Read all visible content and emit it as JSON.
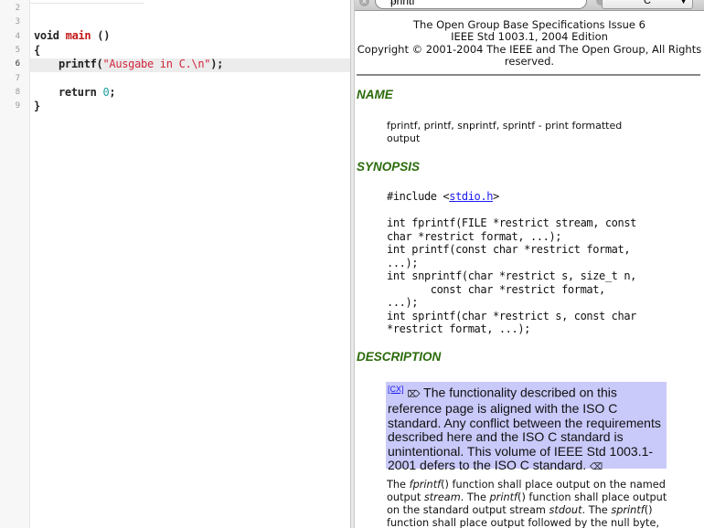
{
  "editor": {
    "line_numbers": [
      "2",
      "3",
      "4",
      "5",
      "6",
      "7",
      "8",
      "9"
    ],
    "current_line": "6",
    "code": {
      "void": "void",
      "main": "main",
      "parens": " ()",
      "open_brace": "{",
      "printf": "printf(",
      "string": "\"Ausgabe in C.\\n\"",
      "printf_end": ");",
      "return": "return ",
      "zero": "0",
      "semi": ";",
      "close_brace": "}"
    }
  },
  "doc": {
    "search_value": "printf",
    "language": "C",
    "header": [
      "The Open Group Base Specifications Issue 6",
      "IEEE Std 1003.1, 2004 Edition",
      "Copyright © 2001-2004 The IEEE and The Open Group, All Rights",
      "reserved."
    ],
    "name_heading": "NAME",
    "name_text": "fprintf, printf, snprintf, sprintf - print formatted output",
    "synopsis_heading": "SYNOPSIS",
    "include_pre": "#include <",
    "include_link": "stdio.h",
    "include_post": ">",
    "synopsis_lines": [
      "int fprintf(FILE *restrict stream, const",
      "char *restrict format, ...);",
      "int printf(const char *restrict format,",
      "...);",
      "int snprintf(char *restrict s, size_t n,",
      "       const char *restrict format,",
      "...);",
      "int sprintf(char *restrict s, const char",
      "*restrict format, ...);"
    ],
    "description_heading": "DESCRIPTION",
    "cx_link": "[CX]",
    "cx_start": "⌦",
    "cx_text": " The functionality described on this reference page is aligned with the ISO C standard. Any conflict between the requirements described here and the ISO C standard is unintentional. This volume of IEEE Std 1003.1-2001 defers to the ISO C standard. ",
    "cx_end": "⌫",
    "para": {
      "t1": "The ",
      "f1": "fprintf",
      "t2": "() function shall place output on the named output ",
      "f2": "stream",
      "t3": ". The ",
      "f3": "printf",
      "t4": "() function shall place output on the standard output stream ",
      "f4": "stdout",
      "t5": ". The ",
      "f5": "sprintf",
      "t6": "() function shall place output followed by the null byte,"
    }
  }
}
